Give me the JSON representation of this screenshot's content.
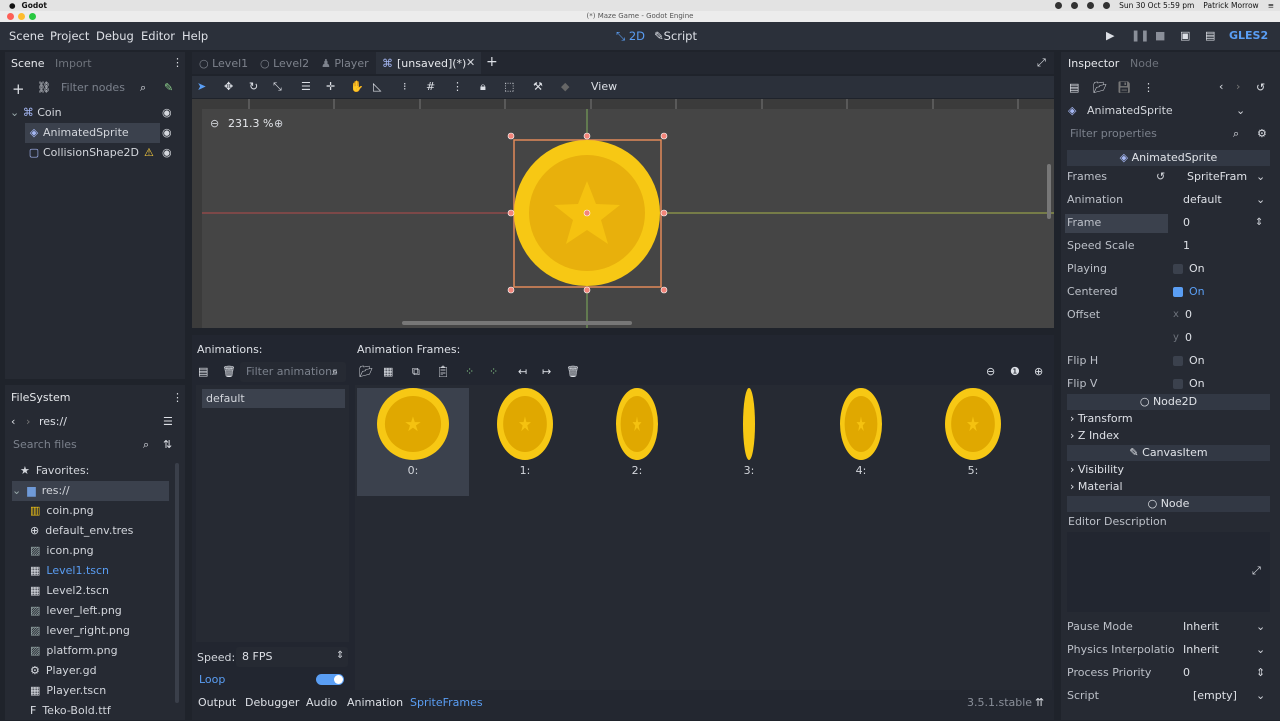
{
  "mac_bar": {
    "app": "Godot",
    "datetime": "Sun 30 Oct  5:59 pm",
    "user": "Patrick Morrow"
  },
  "window_title": "(*) Maze Game - Godot Engine",
  "menu": [
    "Scene",
    "Project",
    "Debug",
    "Editor",
    "Help"
  ],
  "modes": {
    "two_d": "2D",
    "script": "Script"
  },
  "renderer": "GLES2",
  "scene_panel": {
    "tabs": [
      "Scene",
      "Import"
    ],
    "filter_placeholder": "Filter nodes",
    "nodes": [
      "Coin",
      "AnimatedSprite",
      "CollisionShape2D"
    ]
  },
  "editor_tabs": [
    "Level1",
    "Level2",
    "Player",
    "[unsaved](*)"
  ],
  "toolbar": {
    "view": "View"
  },
  "viewport": {
    "zoom": "231.3 %"
  },
  "filesystem": {
    "title": "FileSystem",
    "path": "res://",
    "search_placeholder": "Search files",
    "favorites": "Favorites:",
    "root": "res://",
    "files": [
      {
        "name": "coin.png",
        "icon": "image-strip-icon"
      },
      {
        "name": "default_env.tres",
        "icon": "globe-icon"
      },
      {
        "name": "icon.png",
        "icon": "image-icon"
      },
      {
        "name": "Level1.tscn",
        "icon": "clapper-icon"
      },
      {
        "name": "Level2.tscn",
        "icon": "clapper-icon"
      },
      {
        "name": "lever_left.png",
        "icon": "image-icon"
      },
      {
        "name": "lever_right.png",
        "icon": "image-icon"
      },
      {
        "name": "platform.png",
        "icon": "image-icon"
      },
      {
        "name": "Player.gd",
        "icon": "gear-icon"
      },
      {
        "name": "Player.tscn",
        "icon": "clapper-icon"
      },
      {
        "name": "Teko-Bold.ttf",
        "icon": "font-icon"
      }
    ]
  },
  "animations": {
    "title": "Animations:",
    "filter_placeholder": "Filter animations",
    "list": [
      "default"
    ],
    "speed_label": "Speed:",
    "speed_value": "8 FPS",
    "loop_label": "Loop"
  },
  "frames": {
    "title": "Animation Frames:",
    "items": [
      "0:",
      "1:",
      "2:",
      "3:",
      "4:",
      "5:"
    ]
  },
  "bottom_tabs": [
    "Output",
    "Debugger",
    "Audio",
    "Animation",
    "SpriteFrames"
  ],
  "version": "3.5.1.stable",
  "inspector": {
    "tabs": [
      "Inspector",
      "Node"
    ],
    "object": "AnimatedSprite",
    "filter_placeholder": "Filter properties",
    "class_header": "AnimatedSprite",
    "props": [
      {
        "k": "Frames",
        "v": "SpriteFram"
      },
      {
        "k": "Animation",
        "v": "default"
      },
      {
        "k": "Frame",
        "v": "0"
      },
      {
        "k": "Speed Scale",
        "v": "1"
      },
      {
        "k": "Playing",
        "v": "On"
      },
      {
        "k": "Centered",
        "v": "On"
      },
      {
        "k": "Offset",
        "x_label": "x",
        "x": "0",
        "y_label": "y",
        "y": "0"
      },
      {
        "k": "Flip H",
        "v": "On"
      },
      {
        "k": "Flip V",
        "v": "On"
      }
    ],
    "node2d": "Node2D",
    "transform": "Transform",
    "zindex": "Z Index",
    "canvasitem": "CanvasItem",
    "visibility": "Visibility",
    "material": "Material",
    "node": "Node",
    "editor_description": "Editor Description",
    "bottom_props": [
      {
        "k": "Pause Mode",
        "v": "Inherit"
      },
      {
        "k": "Physics Interpolatio",
        "v": "Inherit"
      },
      {
        "k": "Process Priority",
        "v": "0"
      },
      {
        "k": "Script",
        "v": "[empty]"
      }
    ]
  },
  "colors": {
    "accent": "#5a9ef4",
    "coin": "#f7c814",
    "coin_dark": "#e0a800",
    "bg": "#1f232b",
    "panel": "#262a33"
  }
}
